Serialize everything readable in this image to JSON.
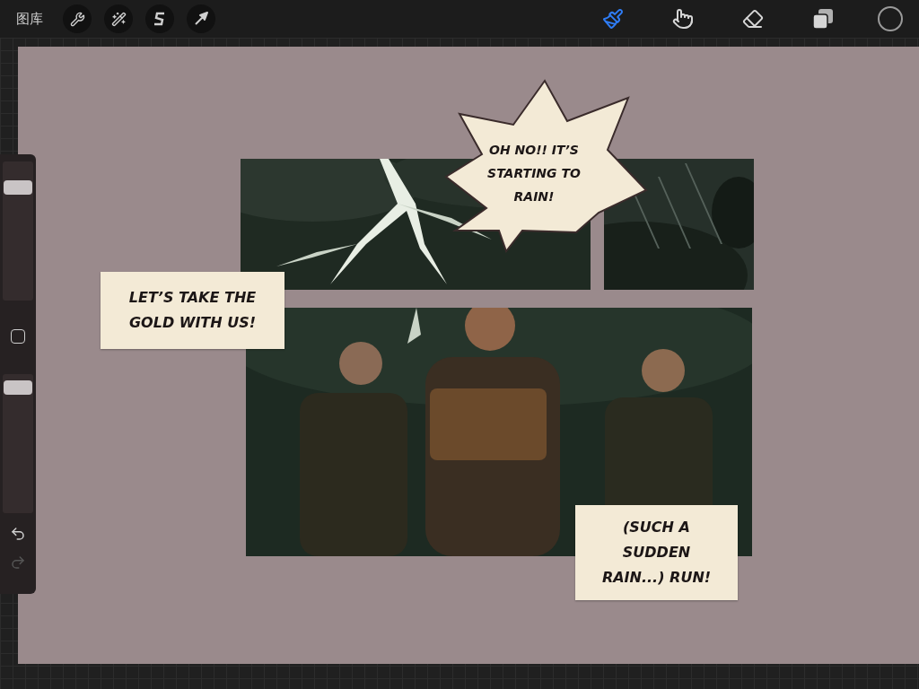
{
  "top_bar": {
    "gallery": "图库",
    "actions": [
      {
        "kind": "wrench"
      },
      {
        "kind": "wand"
      },
      {
        "kind": "selection"
      },
      {
        "kind": "transform"
      }
    ],
    "tools": [
      {
        "kind": "brush",
        "selected": true
      },
      {
        "kind": "smudge",
        "selected": false
      },
      {
        "kind": "eraser",
        "selected": false
      },
      {
        "kind": "layers",
        "selected": false
      }
    ],
    "color": "#1c1c1c"
  },
  "sidebar": {
    "brush_size": {
      "level": 0.85
    },
    "opacity": {
      "level": 0.95
    },
    "undo_disabled": false,
    "redo_disabled": true
  },
  "comic": {
    "bubbles": [
      {
        "kind": "burst",
        "text": "OH NO!! IT’S STARTING TO RAIN!"
      },
      {
        "kind": "caption",
        "text": "LET’S TAKE THE GOLD WITH US!"
      },
      {
        "kind": "caption",
        "text": "(SUCH A SUDDEN RAIN...) RUN!"
      }
    ]
  }
}
